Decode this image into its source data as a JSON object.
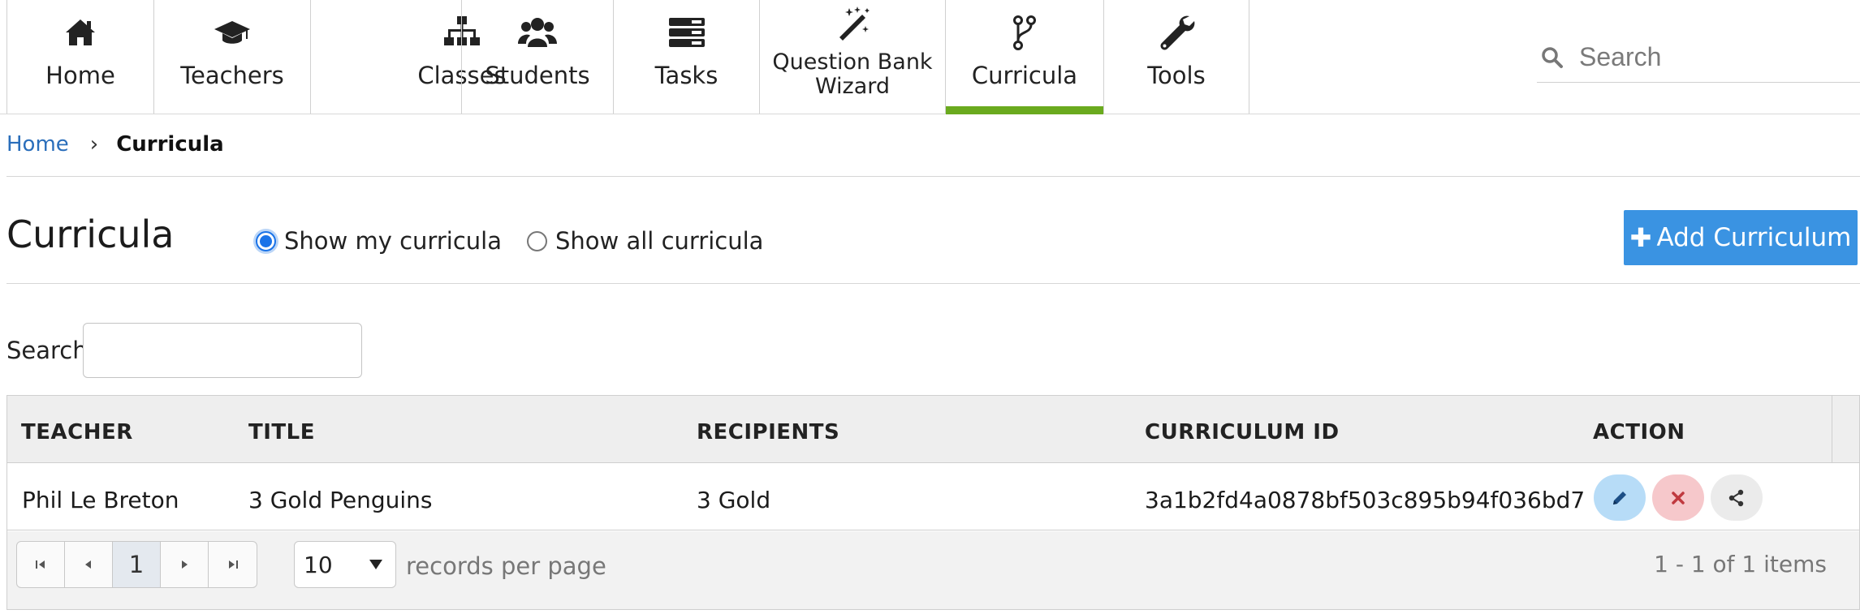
{
  "nav": {
    "tabs": [
      {
        "label": "Home",
        "icon": "home-icon"
      },
      {
        "label": "Teachers",
        "icon": "graduation-cap-icon"
      },
      {
        "label": "Classes",
        "icon": "sitemap-icon"
      },
      {
        "label": "Students",
        "icon": "users-icon"
      },
      {
        "label": "Tasks",
        "icon": "tasks-icon"
      },
      {
        "label": "Question Bank\nWizard",
        "icon": "magic-wand-icon"
      },
      {
        "label": "Curricula",
        "icon": "code-branch-icon",
        "active": true
      },
      {
        "label": "Tools",
        "icon": "wrench-icon"
      }
    ],
    "search_placeholder": "Search",
    "active_color": "#6aaa1e"
  },
  "breadcrumb": {
    "home": "Home",
    "separator": "›",
    "current": "Curricula"
  },
  "page": {
    "title": "Curricula",
    "filter_options": [
      {
        "label": "Show my curricula",
        "selected": true
      },
      {
        "label": "Show all curricula",
        "selected": false
      }
    ],
    "add_button": "Add Curriculum",
    "add_button_color": "#3a93e2",
    "search_label": "Search",
    "search_value": ""
  },
  "grid": {
    "columns": [
      "TEACHER",
      "TITLE",
      "RECIPIENTS",
      "CURRICULUM ID",
      "ACTION"
    ],
    "rows": [
      {
        "teacher": "Phil Le Breton",
        "title": "3 Gold Penguins",
        "recipients": "3 Gold",
        "curriculum_id": "3a1b2fd4a0878bf503c895b94f036bd7",
        "actions": [
          "edit-icon",
          "delete-icon",
          "share-icon"
        ]
      }
    ],
    "pager": {
      "current_page": "1",
      "page_size": "10",
      "page_size_label": "records per page",
      "info": "1 - 1 of 1 items"
    }
  }
}
